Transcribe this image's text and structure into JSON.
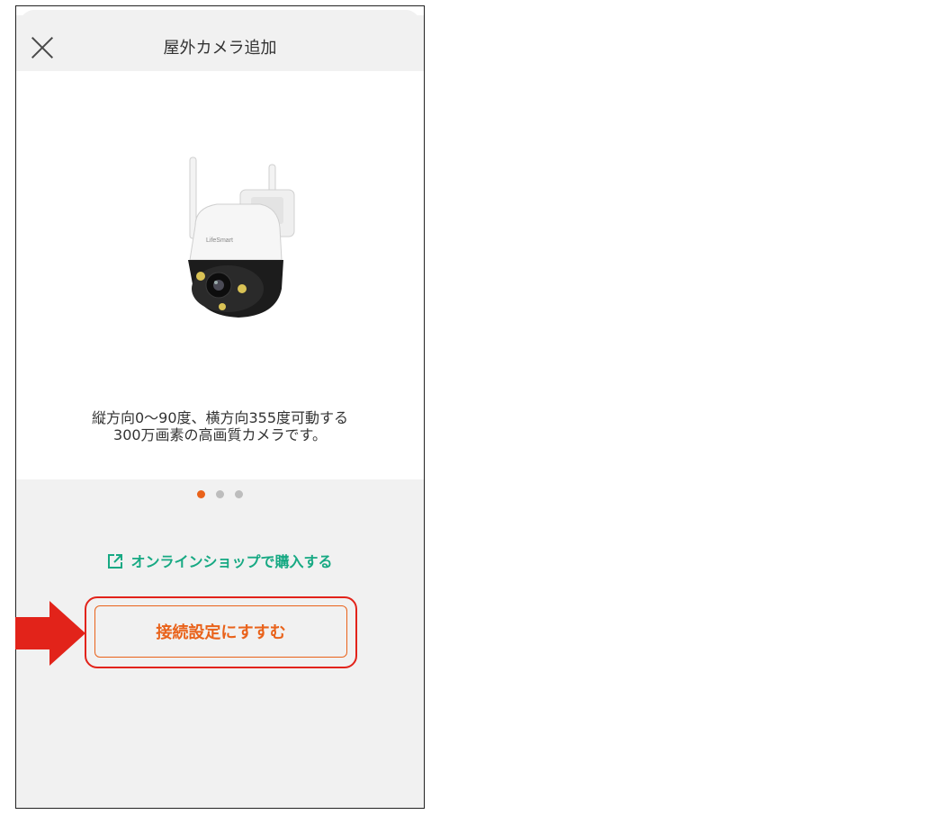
{
  "header": {
    "title": "屋外カメラ追加"
  },
  "product": {
    "brand_label": "LifeSmart",
    "description_line1": "縦方向0〜90度、横方向355度可動する",
    "description_line2": "300万画素の高画質カメラです。"
  },
  "carousel": {
    "total": 3,
    "active_index": 0
  },
  "shop_link": {
    "label": "オンラインショップで購入する",
    "icon": "external-link-icon"
  },
  "cta": {
    "label": "接続設定にすすむ"
  },
  "annotation": {
    "arrow": "red-arrow",
    "highlight": "red-rounded-box"
  },
  "colors": {
    "accent": "#e9621a",
    "link": "#17a983",
    "annotation": "#e2231a"
  }
}
